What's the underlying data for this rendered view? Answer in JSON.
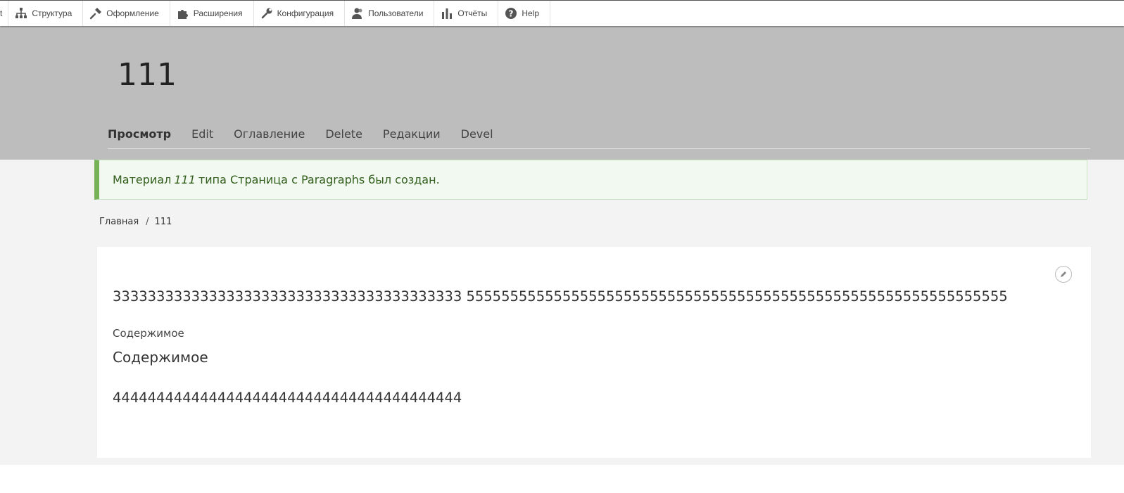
{
  "toolbar": {
    "items": [
      {
        "label": "t",
        "icon": "none"
      },
      {
        "label": "Структура",
        "icon": "structure-icon"
      },
      {
        "label": "Оформление",
        "icon": "appearance-icon"
      },
      {
        "label": "Расширения",
        "icon": "extend-icon"
      },
      {
        "label": "Конфигурация",
        "icon": "wrench-icon"
      },
      {
        "label": "Пользователи",
        "icon": "people-icon"
      },
      {
        "label": "Отчёты",
        "icon": "reports-icon"
      },
      {
        "label": "Help",
        "icon": "help-icon"
      }
    ]
  },
  "header": {
    "title": "111",
    "tabs": [
      {
        "label": "Просмотр",
        "active": true
      },
      {
        "label": "Edit"
      },
      {
        "label": "Оглавление"
      },
      {
        "label": "Delete"
      },
      {
        "label": "Редакции"
      },
      {
        "label": "Devel"
      }
    ]
  },
  "message": {
    "prefix": "Материал",
    "title": "111",
    "suffix": "типа Страница с Paragraphs был создан."
  },
  "breadcrumb": {
    "home": "Главная",
    "separator": "/",
    "current": "111"
  },
  "content": {
    "line1": "3333333333333333333333333333333333333333 55555555555555555555555555555555555555555555555555555555555555",
    "field_label": "Содержимое",
    "field_heading": "Содержимое",
    "line4": "4444444444444444444444444444444444444444",
    "edit_icon": "pencil-icon"
  },
  "colors": {
    "header_bg": "#bdbdbd",
    "message_accent": "#77b259",
    "message_bg": "#f1f9f0",
    "page_bg": "#f3f3f3"
  }
}
